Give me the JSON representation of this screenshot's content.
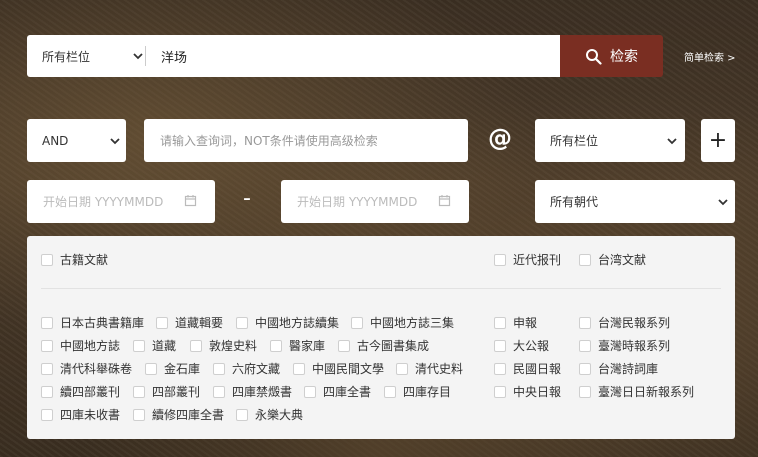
{
  "search": {
    "field": "所有栏位",
    "query": "洋场",
    "button_label": "检索",
    "simple_link": "简单检索 >"
  },
  "advanced": {
    "operator": "AND",
    "input_placeholder": "请输入查询词，NOT条件请使用高级检索",
    "at_symbol": "@",
    "field": "所有栏位",
    "add_label": "+",
    "start_placeholder": "开始日期 YYYYMMDD",
    "end_placeholder": "开始日期 YYYYMMDD",
    "date_separator": "-",
    "dynasty": "所有朝代"
  },
  "collections": {
    "headers": [
      "古籍文献",
      "近代报刊",
      "台湾文献"
    ],
    "left_rows": [
      [
        "日本古典書籍庫",
        "道藏輯要",
        "中國地方誌續集",
        "中國地方誌三集"
      ],
      [
        "中國地方誌",
        "道藏",
        "敦煌史料",
        "醫家庫",
        "古今圖書集成"
      ],
      [
        "清代科舉硃卷",
        "金石庫",
        "六府文藏",
        "中國民間文學",
        "清代史料"
      ],
      [
        "續四部叢刊",
        "四部叢刊",
        "四庫禁燬書",
        "四庫全書",
        "四庫存目"
      ],
      [
        "四庫未收書",
        "續修四庫全書",
        "永樂大典"
      ]
    ],
    "mid_col": [
      "申報",
      "大公報",
      "民國日報",
      "中央日報"
    ],
    "right_col": [
      "台灣民報系列",
      "臺灣時報系列",
      "台灣詩詞庫",
      "臺灣日日新報系列"
    ]
  },
  "colors": {
    "accent": "#7a2e22",
    "panel_bg": "#f4f4f4"
  }
}
